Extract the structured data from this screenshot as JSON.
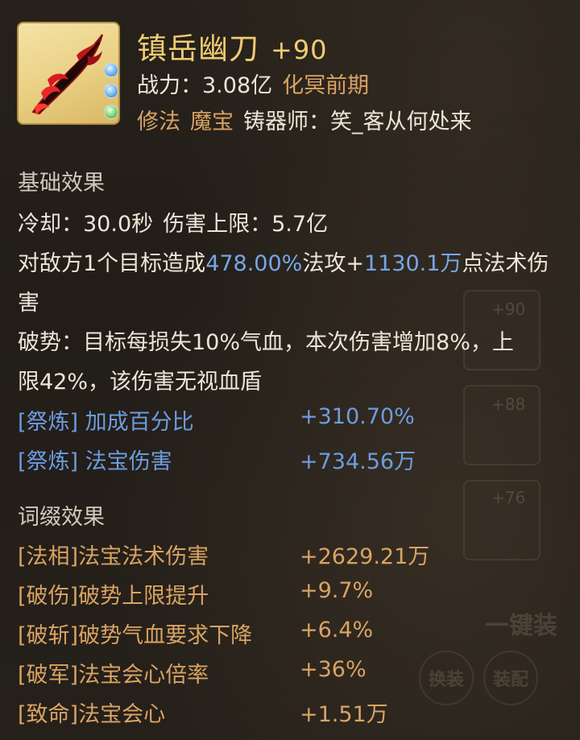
{
  "item": {
    "name": "镇岳幽刀",
    "enhance": "+90",
    "power_label": "战力：",
    "power_value": "3.08亿",
    "realm": "化冥前期",
    "type1": "修法",
    "type2": "魔宝",
    "crafter_label": "铸器师：",
    "crafter_name": "笑_客从何处来"
  },
  "colors": {
    "title_gold": "#f0cc72",
    "orange": "#d9a363",
    "blue": "#76a6e8",
    "text": "#ede6d8",
    "background": "#221d18"
  },
  "base": {
    "heading": "基础效果",
    "cooldown_label": "冷却：",
    "cooldown_value": "30.0秒",
    "cap_label": "伤害上限：",
    "cap_value": "5.7亿",
    "desc1": {
      "a": "对敌方1个目标造成",
      "b": "478.00%",
      "c": "法攻+",
      "d": "1130.1万",
      "e": "点法术伤"
    },
    "desc1_line2": "害",
    "desc2_line1": "破势：目标每损失10%气血，本次伤害增加8%，上",
    "desc2_line2": "限42%，该伤害无视血盾",
    "refine": [
      {
        "tag": "[祭炼]",
        "name": "加成百分比",
        "value": "+310.70%"
      },
      {
        "tag": "[祭炼]",
        "name": "法宝伤害",
        "value": "+734.56万"
      }
    ]
  },
  "affix": {
    "heading": "词缀效果",
    "items": [
      {
        "tag": "[法相]",
        "name": "法宝法术伤害",
        "value": "+2629.21万"
      },
      {
        "tag": "[破伤]",
        "name": "破势上限提升",
        "value": "+9.7%"
      },
      {
        "tag": "[破斩]",
        "name": "破势气血要求下降",
        "value": "+6.4%"
      },
      {
        "tag": "[破军]",
        "name": "法宝会心倍率",
        "value": "+36%"
      },
      {
        "tag": "[致命]",
        "name": "法宝会心",
        "value": "+1.51万"
      }
    ]
  },
  "background_ui": {
    "slot1_plus": "+90",
    "slot2_plus": "+88",
    "slot3_plus": "+76",
    "one_key_button": "一键装",
    "swap_button": "换装",
    "equip_button": "装配"
  },
  "icons": {
    "weapon_icon": "red-black-demon-saber",
    "gem_icons": [
      "blue-gem-icon",
      "blue-gem-icon",
      "green-gem-icon"
    ]
  }
}
